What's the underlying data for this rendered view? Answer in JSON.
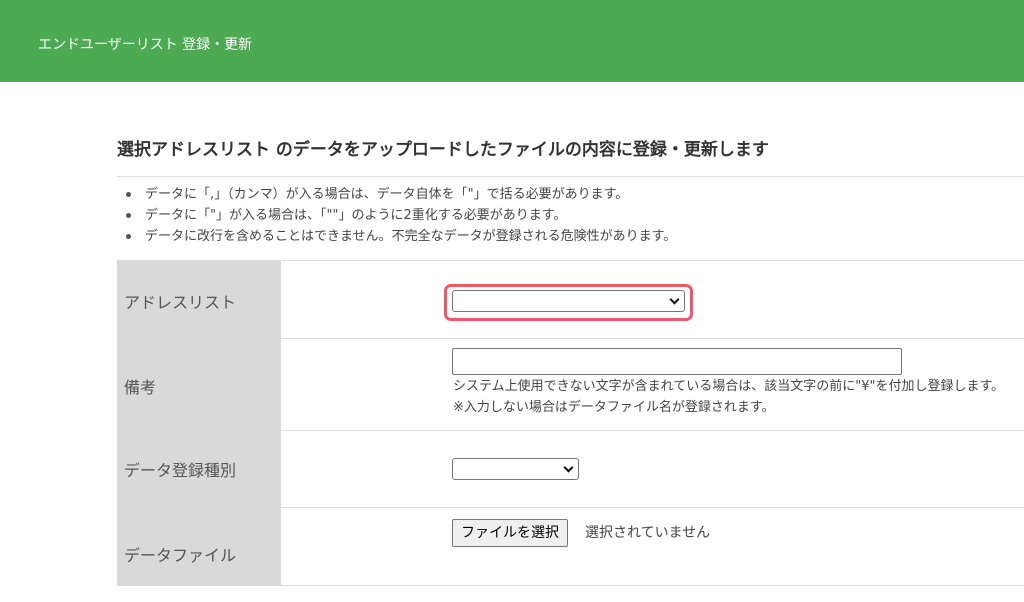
{
  "header": {
    "title": "エンドユーザーリスト 登録・更新",
    "background_color": "#4caa52"
  },
  "section": {
    "title": "選択アドレスリスト のデータをアップロードしたファイルの内容に登録・更新します"
  },
  "notes": [
    "データに「,」（カンマ）が入る場合は、データ自体を「\"」で括る必要があります。",
    "データに「\"」が入る場合は、「\"\"」のように2重化する必要があります。",
    "データに改行を含めることはできません。不完全なデータが登録される危険性があります。"
  ],
  "form": {
    "address_list": {
      "label": "アドレスリスト",
      "value": "",
      "highlight_color": "#f0586a"
    },
    "remarks": {
      "label": "備考",
      "value": "",
      "help_1": "システム上使用できない文字が含まれている場合は、該当文字の前に\"¥\"を付加し登録します。",
      "help_2": "※入力しない場合はデータファイル名が登録されます。"
    },
    "registration_type": {
      "label": "データ登録種別",
      "value": ""
    },
    "data_file": {
      "label": "データファイル",
      "button_label": "ファイルを選択",
      "status": "選択されていません"
    }
  }
}
